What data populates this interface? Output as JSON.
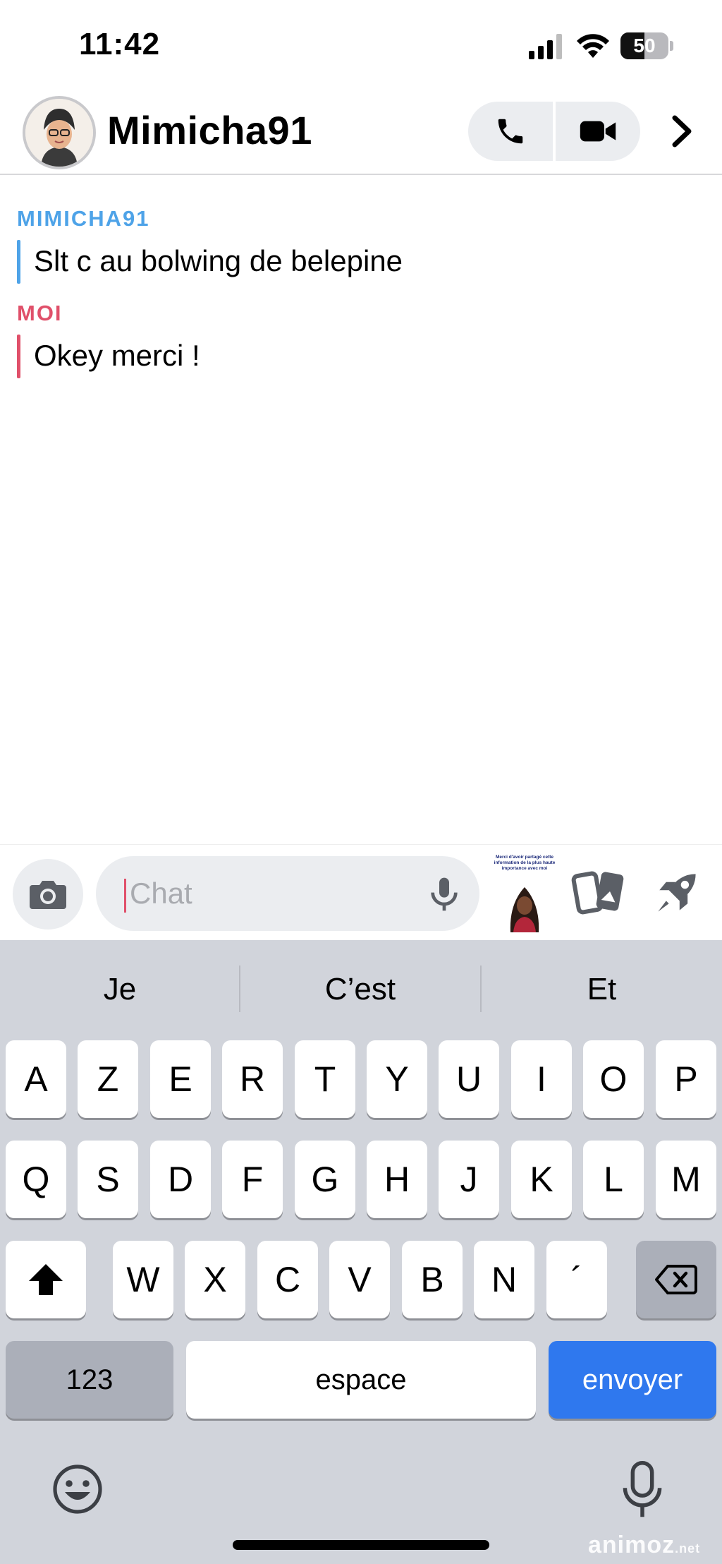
{
  "status_bar": {
    "time": "11:42",
    "battery_level": "50",
    "battery_fraction": 0.5
  },
  "header": {
    "contact_name": "Mimicha91",
    "icons": [
      "back-chevron",
      "phone-icon",
      "video-camera-icon",
      "chevron-right-icon"
    ]
  },
  "messages": [
    {
      "sender": "MIMICHA91",
      "text": "Slt c au bolwing de belepine",
      "color": "#4ea3e8"
    },
    {
      "sender": "MOI",
      "text": "Okey merci !",
      "color": "#e0506a"
    }
  ],
  "composer": {
    "placeholder": "Chat",
    "sticker_caption": "Merci d'avoir partagé cette information de la plus haute importance avec moi"
  },
  "keyboard": {
    "suggestions": [
      "Je",
      "C’est",
      "Et"
    ],
    "row1": [
      "A",
      "Z",
      "E",
      "R",
      "T",
      "Y",
      "U",
      "I",
      "O",
      "P"
    ],
    "row2": [
      "Q",
      "S",
      "D",
      "F",
      "G",
      "H",
      "J",
      "K",
      "L",
      "M"
    ],
    "row3": [
      "W",
      "X",
      "C",
      "V",
      "B",
      "N",
      "´"
    ],
    "numbers_label": "123",
    "space_label": "espace",
    "send_label": "envoyer"
  },
  "watermark": {
    "main": "animoz",
    "suffix": ".net"
  },
  "colors": {
    "accent_blue": "#2f78ee",
    "friend_blue": "#4ea3e8",
    "me_red": "#e0506a",
    "keyboard_bg": "#d1d4db"
  }
}
